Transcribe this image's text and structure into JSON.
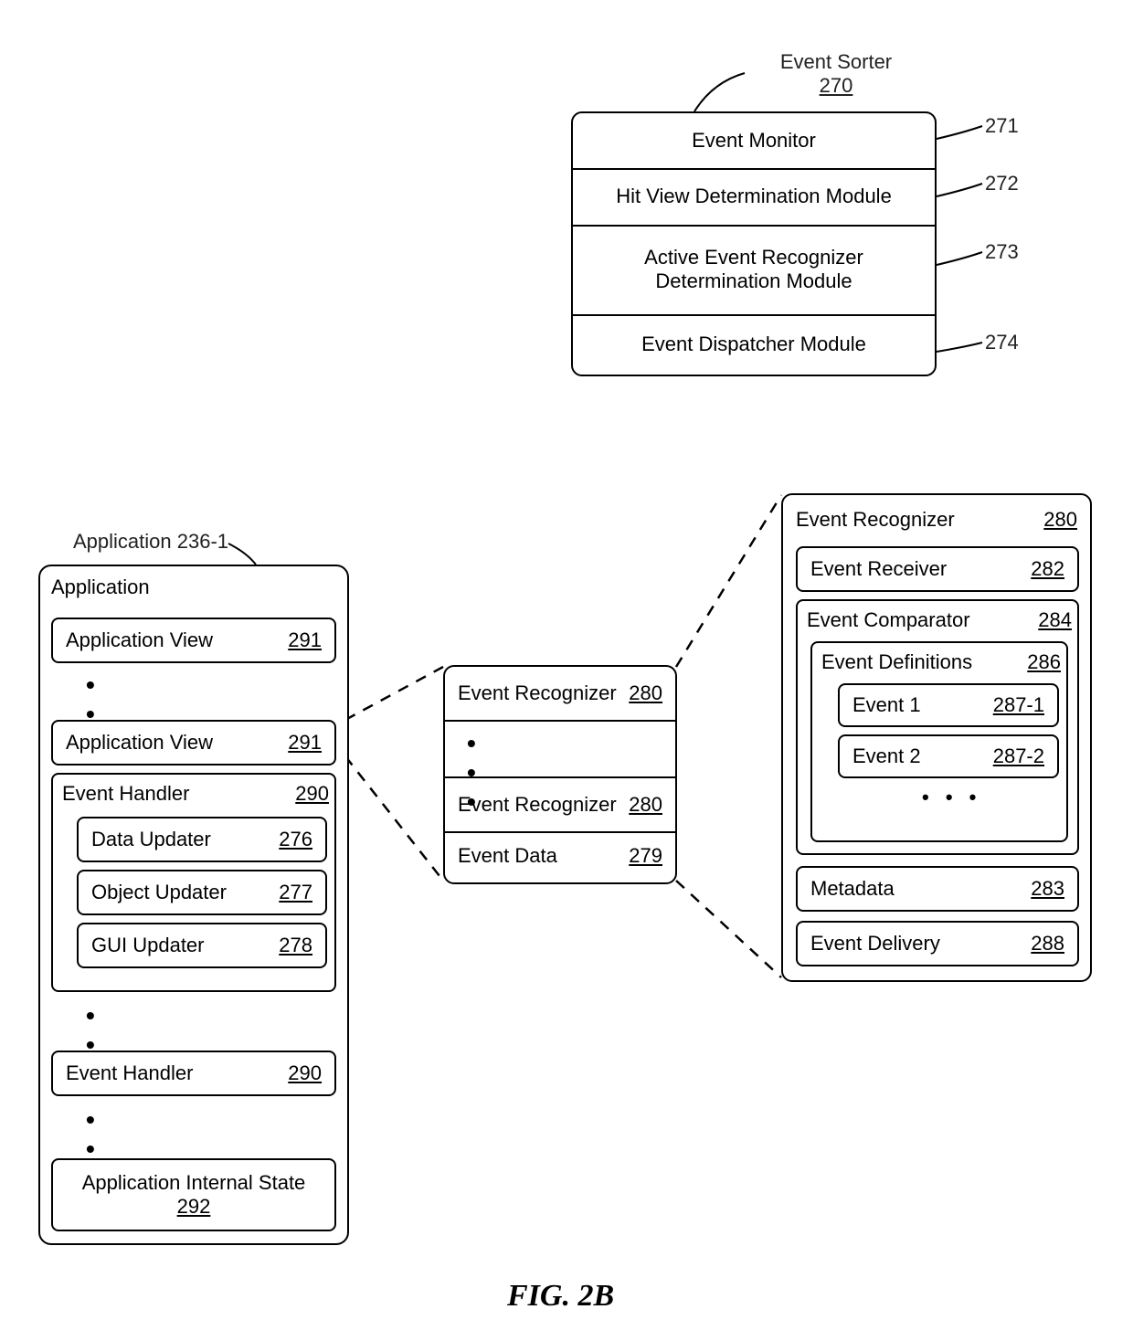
{
  "figure_caption": "FIG. 2B",
  "event_sorter": {
    "title": "Event Sorter",
    "title_num": "270",
    "rows": [
      {
        "label": "Event Monitor",
        "num": "271"
      },
      {
        "label": "Hit View Determination Module",
        "num": "272"
      },
      {
        "label": "Active Event Recognizer Determination Module",
        "num": "273"
      },
      {
        "label": "Event Dispatcher Module",
        "num": "274"
      }
    ]
  },
  "application": {
    "header_label": "Application 236-1",
    "title": "Application",
    "view1": {
      "label": "Application View",
      "num": "291"
    },
    "view2": {
      "label": "Application View",
      "num": "291"
    },
    "event_handler1": {
      "label": "Event Handler",
      "num": "290"
    },
    "data_updater": {
      "label": "Data Updater",
      "num": "276"
    },
    "object_updater": {
      "label": "Object Updater",
      "num": "277"
    },
    "gui_updater": {
      "label": "GUI Updater",
      "num": "278"
    },
    "event_handler2": {
      "label": "Event Handler",
      "num": "290"
    },
    "internal_state": {
      "label": "Application Internal State",
      "num": "292"
    }
  },
  "middle": {
    "rec1": {
      "label": "Event Recognizer",
      "num": "280"
    },
    "rec2": {
      "label": "Event Recognizer",
      "num": "280"
    },
    "event_data": {
      "label": "Event Data",
      "num": "279"
    }
  },
  "recognizer_detail": {
    "title": {
      "label": "Event Recognizer",
      "num": "280"
    },
    "receiver": {
      "label": "Event Receiver",
      "num": "282"
    },
    "comparator": {
      "label": "Event Comparator",
      "num": "284"
    },
    "definitions": {
      "label": "Event Definitions",
      "num": "286"
    },
    "event1": {
      "label": "Event 1",
      "num": "287-1"
    },
    "event2": {
      "label": "Event 2",
      "num": "287-2"
    },
    "metadata": {
      "label": "Metadata",
      "num": "283"
    },
    "delivery": {
      "label": "Event Delivery",
      "num": "288"
    }
  }
}
